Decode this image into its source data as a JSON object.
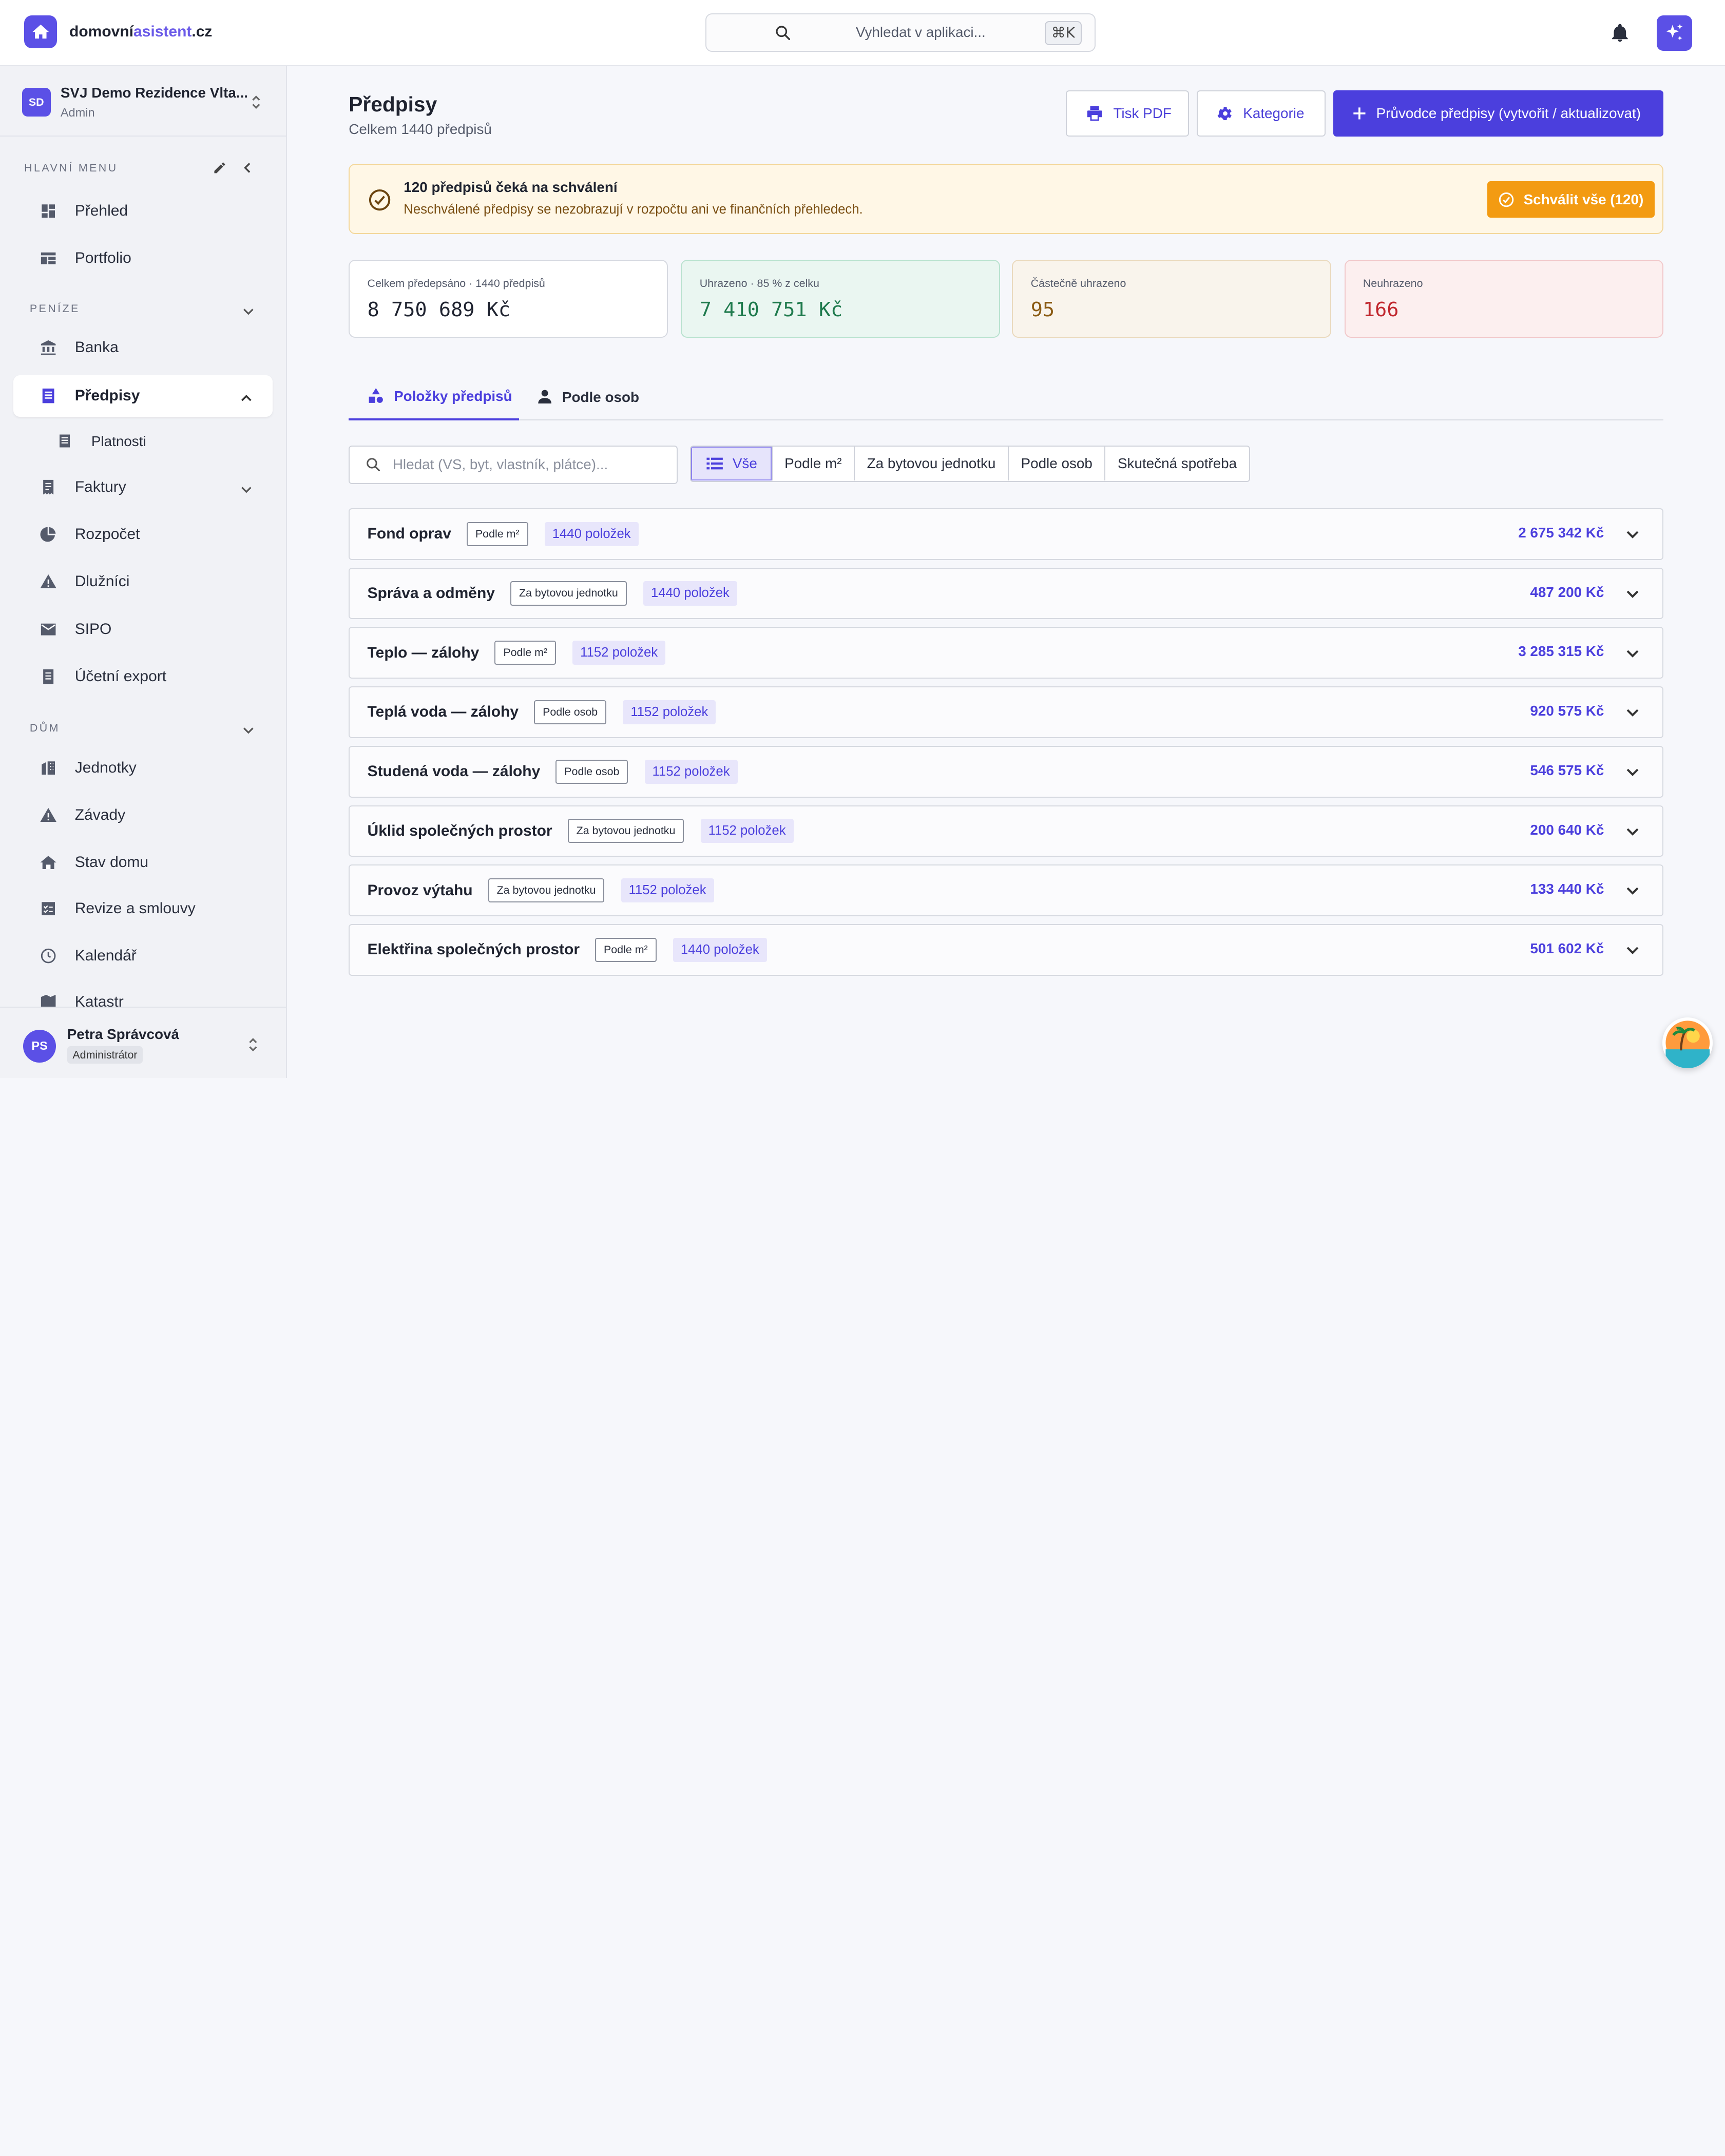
{
  "topbar": {
    "brand_part1": "domovní",
    "brand_part2": "asistent",
    "brand_part3": ".cz",
    "search_placeholder": "Vyhledat v aplikaci...",
    "shortcut": "⌘K"
  },
  "sidebar": {
    "org_initials": "SD",
    "org_name": "SVJ Demo Rezidence Vlta...",
    "org_role": "Admin",
    "section_main": "HLAVNÍ MENU",
    "section_money": "PENÍZE",
    "section_house": "DŮM",
    "items": {
      "prehled": "Přehled",
      "portfolio": "Portfolio",
      "banka": "Banka",
      "predpisy": "Předpisy",
      "platnosti": "Platnosti",
      "faktury": "Faktury",
      "rozpocet": "Rozpočet",
      "dluznici": "Dlužníci",
      "sipo": "SIPO",
      "ucetni_export": "Účetní export",
      "jednotky": "Jednotky",
      "zavady": "Závady",
      "stav_domu": "Stav domu",
      "revize": "Revize a smlouvy",
      "kalendar": "Kalendář",
      "katastr": "Katastr"
    },
    "user_initials": "PS",
    "user_name": "Petra Správcová",
    "user_role": "Administrátor"
  },
  "page": {
    "title": "Předpisy",
    "subtitle": "Celkem 1440 předpisů",
    "btn_print": "Tisk PDF",
    "btn_categories": "Kategorie",
    "btn_wizard": "Průvodce předpisy (vytvořit / aktualizovat)"
  },
  "alert": {
    "title": "120 předpisů čeká na schválení",
    "text": "Neschválené předpisy se nezobrazují v rozpočtu ani ve finančních přehledech.",
    "button": "Schválit vše (120)"
  },
  "stats": [
    {
      "label": "Celkem předepsáno · 1440 předpisů",
      "value": "8 750 689 Kč",
      "color": "#1f2330"
    },
    {
      "label": "Uhrazeno · 85 % z celku",
      "value": "7 410 751 Kč",
      "color": "#1f7a4d"
    },
    {
      "label": "Částečně uhrazeno",
      "value": "95",
      "color": "#8a5a12"
    },
    {
      "label": "Neuhrazeno",
      "value": "166",
      "color": "#c0262d"
    }
  ],
  "tabs": {
    "items": "Položky předpisů",
    "persons": "Podle osob"
  },
  "filter": {
    "search_placeholder": "Hledat (VS, byt, vlastník, plátce)...",
    "segments": [
      "Vše",
      "Podle m²",
      "Za bytovou jednotku",
      "Podle osob",
      "Skutečná spotřeba"
    ]
  },
  "rows": [
    {
      "name": "Fond oprav",
      "method": "Podle m²",
      "count": "1440 položek",
      "amount": "2 675 342 Kč"
    },
    {
      "name": "Správa a odměny",
      "method": "Za bytovou jednotku",
      "count": "1440 položek",
      "amount": "487 200 Kč"
    },
    {
      "name": "Teplo — zálohy",
      "method": "Podle m²",
      "count": "1152 položek",
      "amount": "3 285 315 Kč"
    },
    {
      "name": "Teplá voda — zálohy",
      "method": "Podle osob",
      "count": "1152 položek",
      "amount": "920 575 Kč"
    },
    {
      "name": "Studená voda — zálohy",
      "method": "Podle osob",
      "count": "1152 položek",
      "amount": "546 575 Kč"
    },
    {
      "name": "Úklid společných prostor",
      "method": "Za bytovou jednotku",
      "count": "1152 položek",
      "amount": "200 640 Kč"
    },
    {
      "name": "Provoz výtahu",
      "method": "Za bytovou jednotku",
      "count": "1152 položek",
      "amount": "133 440 Kč"
    },
    {
      "name": "Elektřina společných prostor",
      "method": "Podle m²",
      "count": "1440 položek",
      "amount": "501 602 Kč"
    }
  ],
  "colors": {
    "accent": "#4b3fdd",
    "warning": "#f39b12"
  }
}
